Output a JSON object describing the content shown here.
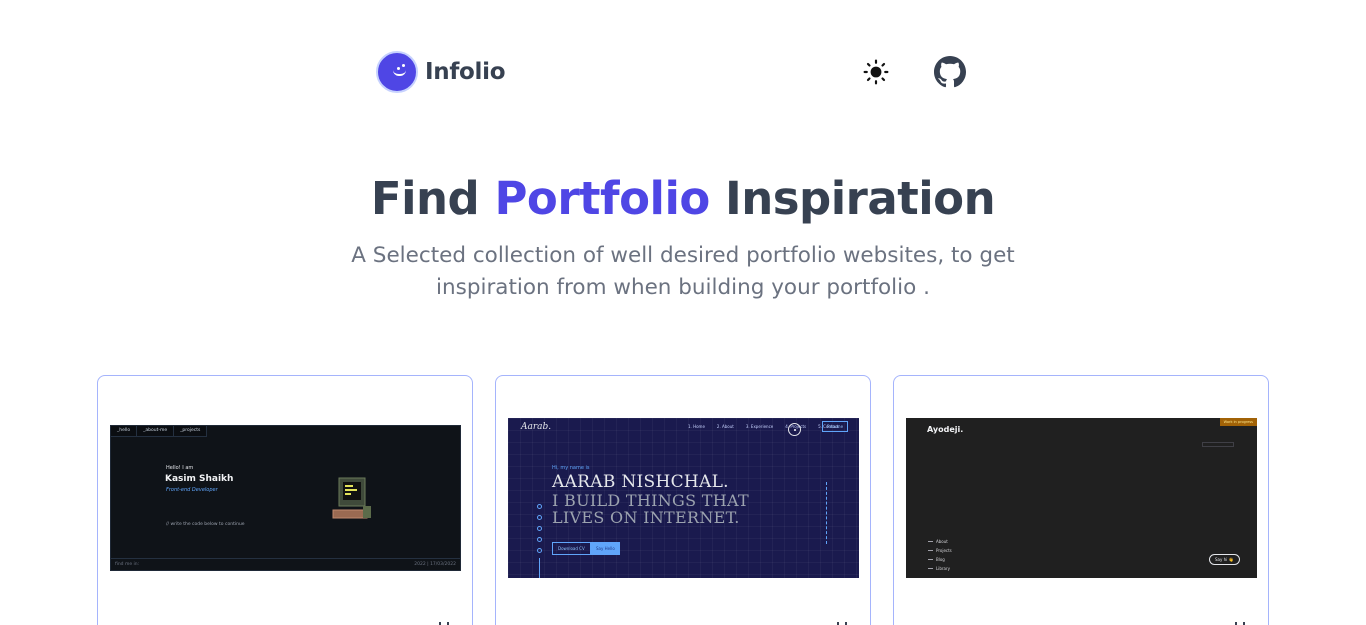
{
  "header": {
    "logo_text": "Infolio",
    "theme_toggle_icon": "sun-icon",
    "github_icon": "github-icon"
  },
  "hero": {
    "title_prefix": "Find ",
    "title_accent": "Portfolio",
    "title_suffix": " Inspiration",
    "subtitle_line1": "A Selected collection of well desired portfolio websites, to get",
    "subtitle_line2": "inspiration from when building your portfolio ."
  },
  "colors": {
    "accent": "#4f46e5",
    "text": "#374151",
    "muted": "#6b7280",
    "card_border": "#a5b4fc"
  },
  "cards": [
    {
      "thumb": {
        "tabs": [
          "_hello",
          "_about-me",
          "_projects"
        ],
        "hello": "Hello! I am",
        "name": "Kasim Shaikh",
        "role": "Front-end Developer",
        "comment": "// write the code below to continue",
        "footer_left": "find me in:",
        "footer_right": "2022 | 17/03/2022"
      }
    },
    {
      "thumb": {
        "logo": "Aarab.",
        "nav": [
          "1. Home",
          "2. About",
          "3. Experience",
          "4. Projects",
          "5. Contact"
        ],
        "resume": "Resume",
        "greeting": "Hi, my name is",
        "line1": "AARAB NISHCHAL.",
        "line2": "I BUILD THINGS THAT",
        "line3": "LIVES ON INTERNET.",
        "btn_cv": "Download CV",
        "btn_hello": "Say Hello"
      }
    },
    {
      "thumb": {
        "logo": "Ayodeji.",
        "tag": "Work in progress",
        "menu": [
          "About",
          "Projects",
          "Blog",
          "Library"
        ],
        "say_hi": "Say hi 👋"
      }
    }
  ]
}
